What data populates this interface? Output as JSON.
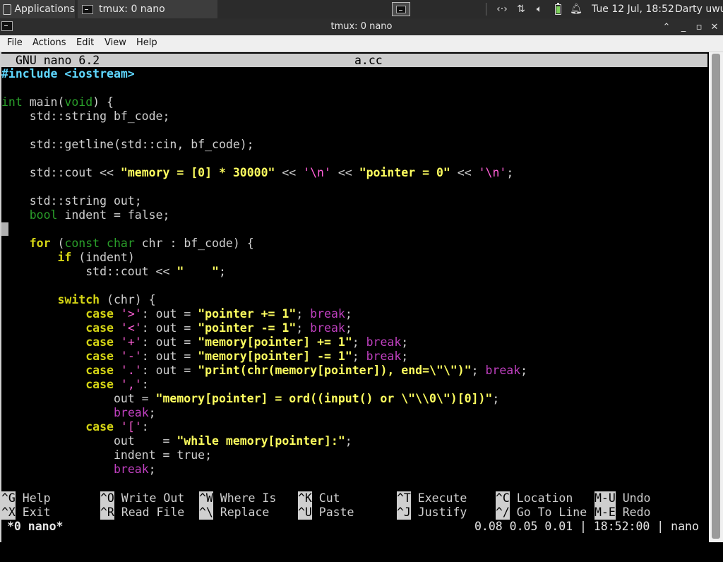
{
  "panel": {
    "applications_label": "Applications",
    "task_label": "tmux: 0 nano",
    "clock": "Tue 12 Jul, 18:52",
    "user": "Darty uwu",
    "icons": [
      "terminal-icon",
      "network-arrows-icon",
      "transfer-icon",
      "volume-icon",
      "battery-icon",
      "notification-bell-icon"
    ],
    "battery_level_percent": 80,
    "battery_color": "#7ccf5a"
  },
  "window": {
    "title": "tmux: 0 nano"
  },
  "menubar": [
    "File",
    "Actions",
    "Edit",
    "View",
    "Help"
  ],
  "nano": {
    "version": "GNU nano 6.2",
    "filename": "a.cc",
    "colors": {
      "preprocessor": "#5fd7ff",
      "type": "#2aa02a",
      "keyword": "#d4d414",
      "string": "#ffff5f",
      "char_literal": "#ff5fd7",
      "break": "#c040c0",
      "text": "#d0d0d0",
      "header_bg": "#cccccc"
    },
    "lines": [
      [
        {
          "t": "#include <iostream>",
          "c": "pp"
        }
      ],
      [],
      [
        {
          "t": "int",
          "c": "ty"
        },
        {
          "t": " main(",
          "c": "nm"
        },
        {
          "t": "void",
          "c": "ty"
        },
        {
          "t": ") {",
          "c": "nm"
        }
      ],
      [
        {
          "t": "    std::string bf_code;",
          "c": "nm"
        }
      ],
      [],
      [
        {
          "t": "    std::getline(std::cin, bf_code);",
          "c": "nm"
        }
      ],
      [],
      [
        {
          "t": "    std::cout << ",
          "c": "nm"
        },
        {
          "t": "\"memory = [0] * 30000\"",
          "c": "st"
        },
        {
          "t": " << ",
          "c": "nm"
        },
        {
          "t": "'\\n'",
          "c": "ch"
        },
        {
          "t": " << ",
          "c": "nm"
        },
        {
          "t": "\"pointer = 0\"",
          "c": "st"
        },
        {
          "t": " << ",
          "c": "nm"
        },
        {
          "t": "'\\n'",
          "c": "ch"
        },
        {
          "t": ";",
          "c": "nm"
        }
      ],
      [],
      [
        {
          "t": "    std::string out;",
          "c": "nm"
        }
      ],
      [
        {
          "t": "    ",
          "c": "nm"
        },
        {
          "t": "bool",
          "c": "ty"
        },
        {
          "t": " indent = false;",
          "c": "nm"
        }
      ],
      [],
      [
        {
          "t": "    ",
          "c": "nm"
        },
        {
          "t": "for",
          "c": "kw"
        },
        {
          "t": " (",
          "c": "nm"
        },
        {
          "t": "const char",
          "c": "ty"
        },
        {
          "t": " chr : bf_code) {",
          "c": "nm"
        }
      ],
      [
        {
          "t": "        ",
          "c": "nm"
        },
        {
          "t": "if",
          "c": "kw"
        },
        {
          "t": " (indent)",
          "c": "nm"
        }
      ],
      [
        {
          "t": "            std::cout << ",
          "c": "nm"
        },
        {
          "t": "\"    \"",
          "c": "st"
        },
        {
          "t": ";",
          "c": "nm"
        }
      ],
      [],
      [
        {
          "t": "        ",
          "c": "nm"
        },
        {
          "t": "switch",
          "c": "kw"
        },
        {
          "t": " (chr) {",
          "c": "nm"
        }
      ],
      [
        {
          "t": "            ",
          "c": "nm"
        },
        {
          "t": "case",
          "c": "kw"
        },
        {
          "t": " ",
          "c": "nm"
        },
        {
          "t": "'>'",
          "c": "ch"
        },
        {
          "t": ": out = ",
          "c": "nm"
        },
        {
          "t": "\"pointer += 1\"",
          "c": "st"
        },
        {
          "t": "; ",
          "c": "nm"
        },
        {
          "t": "break",
          "c": "br"
        },
        {
          "t": ";",
          "c": "nm"
        }
      ],
      [
        {
          "t": "            ",
          "c": "nm"
        },
        {
          "t": "case",
          "c": "kw"
        },
        {
          "t": " ",
          "c": "nm"
        },
        {
          "t": "'<'",
          "c": "ch"
        },
        {
          "t": ": out = ",
          "c": "nm"
        },
        {
          "t": "\"pointer -= 1\"",
          "c": "st"
        },
        {
          "t": "; ",
          "c": "nm"
        },
        {
          "t": "break",
          "c": "br"
        },
        {
          "t": ";",
          "c": "nm"
        }
      ],
      [
        {
          "t": "            ",
          "c": "nm"
        },
        {
          "t": "case",
          "c": "kw"
        },
        {
          "t": " ",
          "c": "nm"
        },
        {
          "t": "'+'",
          "c": "ch"
        },
        {
          "t": ": out = ",
          "c": "nm"
        },
        {
          "t": "\"memory[pointer] += 1\"",
          "c": "st"
        },
        {
          "t": "; ",
          "c": "nm"
        },
        {
          "t": "break",
          "c": "br"
        },
        {
          "t": ";",
          "c": "nm"
        }
      ],
      [
        {
          "t": "            ",
          "c": "nm"
        },
        {
          "t": "case",
          "c": "kw"
        },
        {
          "t": " ",
          "c": "nm"
        },
        {
          "t": "'-'",
          "c": "ch"
        },
        {
          "t": ": out = ",
          "c": "nm"
        },
        {
          "t": "\"memory[pointer] -= 1\"",
          "c": "st"
        },
        {
          "t": "; ",
          "c": "nm"
        },
        {
          "t": "break",
          "c": "br"
        },
        {
          "t": ";",
          "c": "nm"
        }
      ],
      [
        {
          "t": "            ",
          "c": "nm"
        },
        {
          "t": "case",
          "c": "kw"
        },
        {
          "t": " ",
          "c": "nm"
        },
        {
          "t": "'.'",
          "c": "ch"
        },
        {
          "t": ": out = ",
          "c": "nm"
        },
        {
          "t": "\"print(chr(memory[pointer]), end=\\\"\\\")\"",
          "c": "st"
        },
        {
          "t": "; ",
          "c": "nm"
        },
        {
          "t": "break",
          "c": "br"
        },
        {
          "t": ";",
          "c": "nm"
        }
      ],
      [
        {
          "t": "            ",
          "c": "nm"
        },
        {
          "t": "case",
          "c": "kw"
        },
        {
          "t": " ",
          "c": "nm"
        },
        {
          "t": "','",
          "c": "ch"
        },
        {
          "t": ":",
          "c": "nm"
        }
      ],
      [
        {
          "t": "                out = ",
          "c": "nm"
        },
        {
          "t": "\"memory[pointer] = ord((input() or \\\"\\\\0\\\")[0])\"",
          "c": "st"
        },
        {
          "t": ";",
          "c": "nm"
        }
      ],
      [
        {
          "t": "                ",
          "c": "nm"
        },
        {
          "t": "break",
          "c": "br"
        },
        {
          "t": ";",
          "c": "nm"
        }
      ],
      [
        {
          "t": "            ",
          "c": "nm"
        },
        {
          "t": "case",
          "c": "kw"
        },
        {
          "t": " ",
          "c": "nm"
        },
        {
          "t": "'['",
          "c": "ch"
        },
        {
          "t": ":",
          "c": "nm"
        }
      ],
      [
        {
          "t": "                out    = ",
          "c": "nm"
        },
        {
          "t": "\"while memory[pointer]:\"",
          "c": "st"
        },
        {
          "t": ";",
          "c": "nm"
        }
      ],
      [
        {
          "t": "                indent = true;",
          "c": "nm"
        }
      ],
      [
        {
          "t": "                ",
          "c": "nm"
        },
        {
          "t": "break",
          "c": "br"
        },
        {
          "t": ";",
          "c": "nm"
        }
      ]
    ],
    "shortcuts": [
      [
        {
          "key": "^G",
          "label": "Help"
        },
        {
          "key": "^O",
          "label": "Write Out"
        },
        {
          "key": "^W",
          "label": "Where Is"
        },
        {
          "key": "^K",
          "label": "Cut"
        },
        {
          "key": "^T",
          "label": "Execute"
        },
        {
          "key": "^C",
          "label": "Location"
        },
        {
          "key": "M-U",
          "label": "Undo"
        }
      ],
      [
        {
          "key": "^X",
          "label": "Exit"
        },
        {
          "key": "^R",
          "label": "Read File"
        },
        {
          "key": "^\\",
          "label": "Replace"
        },
        {
          "key": "^U",
          "label": "Paste"
        },
        {
          "key": "^J",
          "label": "Justify"
        },
        {
          "key": "^/",
          "label": "Go To Line"
        },
        {
          "key": "M-E",
          "label": "Redo"
        }
      ]
    ]
  },
  "tmux": {
    "status_left": "*0 nano*",
    "status_right": "0.08 0.05 0.01 | 18:52:00 | nano"
  }
}
